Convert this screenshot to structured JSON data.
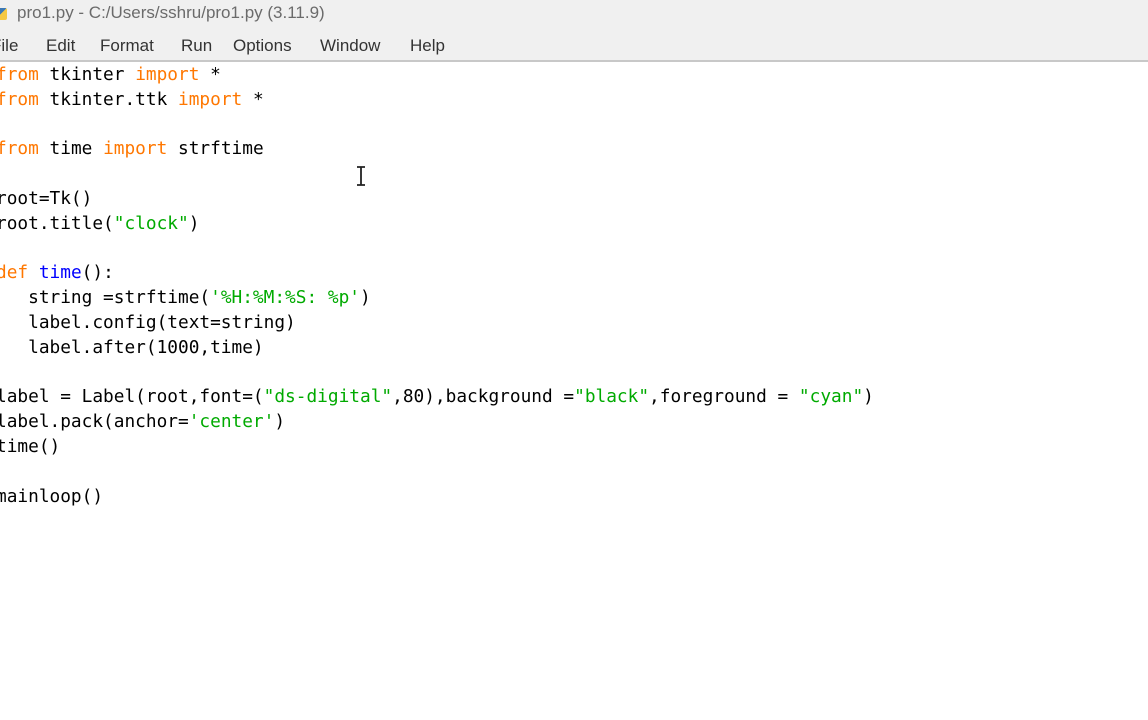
{
  "window": {
    "title": "pro1.py - C:/Users/sshru/pro1.py (3.11.9)",
    "icon": "python-idle-icon"
  },
  "menubar": {
    "items": [
      "File",
      "Edit",
      "Format",
      "Run",
      "Options",
      "Window",
      "Help"
    ]
  },
  "editor": {
    "lines": [
      {
        "index": 0,
        "tokens": [
          {
            "text": "from",
            "type": "keyword"
          },
          {
            "text": " tkinter ",
            "type": "plain"
          },
          {
            "text": "import",
            "type": "keyword"
          },
          {
            "text": " *",
            "type": "plain"
          }
        ]
      },
      {
        "index": 1,
        "tokens": [
          {
            "text": "from",
            "type": "keyword"
          },
          {
            "text": " tkinter.ttk ",
            "type": "plain"
          },
          {
            "text": "import",
            "type": "keyword"
          },
          {
            "text": " *",
            "type": "plain"
          }
        ]
      },
      {
        "index": 3,
        "tokens": [
          {
            "text": "from",
            "type": "keyword"
          },
          {
            "text": " time ",
            "type": "plain"
          },
          {
            "text": "import",
            "type": "keyword"
          },
          {
            "text": " strftime",
            "type": "plain"
          }
        ]
      },
      {
        "index": 5,
        "tokens": [
          {
            "text": "root=Tk()",
            "type": "plain"
          }
        ]
      },
      {
        "index": 6,
        "tokens": [
          {
            "text": "root.title(",
            "type": "plain"
          },
          {
            "text": "\"clock\"",
            "type": "string"
          },
          {
            "text": ")",
            "type": "plain"
          }
        ]
      },
      {
        "index": 8,
        "tokens": [
          {
            "text": "def",
            "type": "keyword"
          },
          {
            "text": " ",
            "type": "plain"
          },
          {
            "text": "time",
            "type": "def"
          },
          {
            "text": "():",
            "type": "plain"
          }
        ]
      },
      {
        "index": 9,
        "tokens": [
          {
            "text": "   string =strftime(",
            "type": "plain"
          },
          {
            "text": "'%H:%M:%S: %p'",
            "type": "string"
          },
          {
            "text": ")",
            "type": "plain"
          }
        ]
      },
      {
        "index": 10,
        "tokens": [
          {
            "text": "   label.config(text=string)",
            "type": "plain"
          }
        ]
      },
      {
        "index": 11,
        "tokens": [
          {
            "text": "   label.after(1000,time)",
            "type": "plain"
          }
        ]
      },
      {
        "index": 13,
        "tokens": [
          {
            "text": "label = Label(root,font=(",
            "type": "plain"
          },
          {
            "text": "\"ds-digital\"",
            "type": "string"
          },
          {
            "text": ",80),background =",
            "type": "plain"
          },
          {
            "text": "\"black\"",
            "type": "string"
          },
          {
            "text": ",foreground = ",
            "type": "plain"
          },
          {
            "text": "\"cyan\"",
            "type": "string"
          },
          {
            "text": ")",
            "type": "plain"
          }
        ]
      },
      {
        "index": 14,
        "tokens": [
          {
            "text": "label.pack(anchor=",
            "type": "plain"
          },
          {
            "text": "'center'",
            "type": "string"
          },
          {
            "text": ")",
            "type": "plain"
          }
        ]
      },
      {
        "index": 15,
        "tokens": [
          {
            "text": "time()",
            "type": "plain"
          }
        ]
      },
      {
        "index": 17,
        "tokens": [
          {
            "text": "mainloop()",
            "type": "plain"
          }
        ]
      }
    ]
  },
  "colors": {
    "keyword": "#ff7700",
    "string": "#00aa00",
    "def": "#0000ff",
    "plain": "#000000"
  },
  "pointer": "text-cursor-icon"
}
